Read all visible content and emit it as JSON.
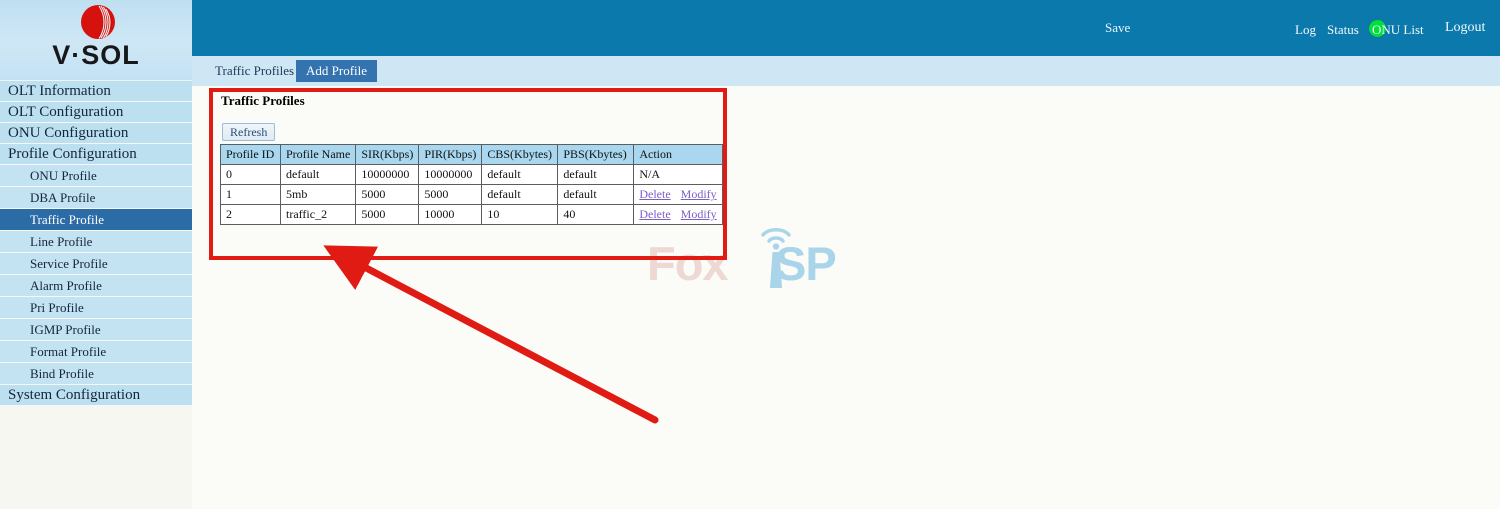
{
  "brand": {
    "name": "V·SOL",
    "logo_icon": "vsol-logo-icon"
  },
  "topbar": {
    "save_label": "Save",
    "status_dot_color": "#00e03c",
    "links": [
      {
        "label": "Log",
        "name": "log"
      },
      {
        "label": "Status",
        "name": "status"
      },
      {
        "label": "ONU List",
        "name": "onu-list"
      },
      {
        "label": "Logout",
        "name": "logout"
      }
    ]
  },
  "sidebar": {
    "items": [
      {
        "label": "OLT Information",
        "level": "top",
        "selected": false
      },
      {
        "label": "OLT Configuration",
        "level": "top",
        "selected": false
      },
      {
        "label": "ONU Configuration",
        "level": "top",
        "selected": false
      },
      {
        "label": "Profile Configuration",
        "level": "top",
        "selected": false
      },
      {
        "label": "ONU Profile",
        "level": "child",
        "selected": false
      },
      {
        "label": "DBA Profile",
        "level": "child",
        "selected": false
      },
      {
        "label": "Traffic Profile",
        "level": "child",
        "selected": true
      },
      {
        "label": "Line Profile",
        "level": "child",
        "selected": false
      },
      {
        "label": "Service Profile",
        "level": "child",
        "selected": false
      },
      {
        "label": "Alarm Profile",
        "level": "child",
        "selected": false
      },
      {
        "label": "Pri Profile",
        "level": "child",
        "selected": false
      },
      {
        "label": "IGMP Profile",
        "level": "child",
        "selected": false
      },
      {
        "label": "Format Profile",
        "level": "child",
        "selected": false
      },
      {
        "label": "Bind Profile",
        "level": "child",
        "selected": false
      },
      {
        "label": "System Configuration",
        "level": "top",
        "selected": false
      }
    ]
  },
  "tabs": [
    {
      "label": "Traffic Profiles",
      "active": false
    },
    {
      "label": "Add Profile",
      "active": true
    }
  ],
  "panel": {
    "title": "Traffic Profiles",
    "refresh_label": "Refresh"
  },
  "table": {
    "columns": [
      "Profile ID",
      "Profile Name",
      "SIR(Kbps)",
      "PIR(Kbps)",
      "CBS(Kbytes)",
      "PBS(Kbytes)",
      "Action"
    ],
    "rows": [
      {
        "cells": [
          "0",
          "default",
          "10000000",
          "10000000",
          "default",
          "default"
        ],
        "action_text": "N/A",
        "action_links": []
      },
      {
        "cells": [
          "1",
          "5mb",
          "5000",
          "5000",
          "default",
          "default"
        ],
        "action_text": "",
        "action_links": [
          "Delete",
          "Modify"
        ]
      },
      {
        "cells": [
          "2",
          "traffic_2",
          "5000",
          "10000",
          "10",
          "40"
        ],
        "action_text": "",
        "action_links": [
          "Delete",
          "Modify"
        ]
      }
    ]
  },
  "watermark": {
    "text_a": "Fox",
    "text_b": "SP",
    "tower_icon": "wifi-tower-icon"
  },
  "annotations": {
    "highlight_box_color": "#e01b14",
    "arrow_color": "#e01b14"
  }
}
